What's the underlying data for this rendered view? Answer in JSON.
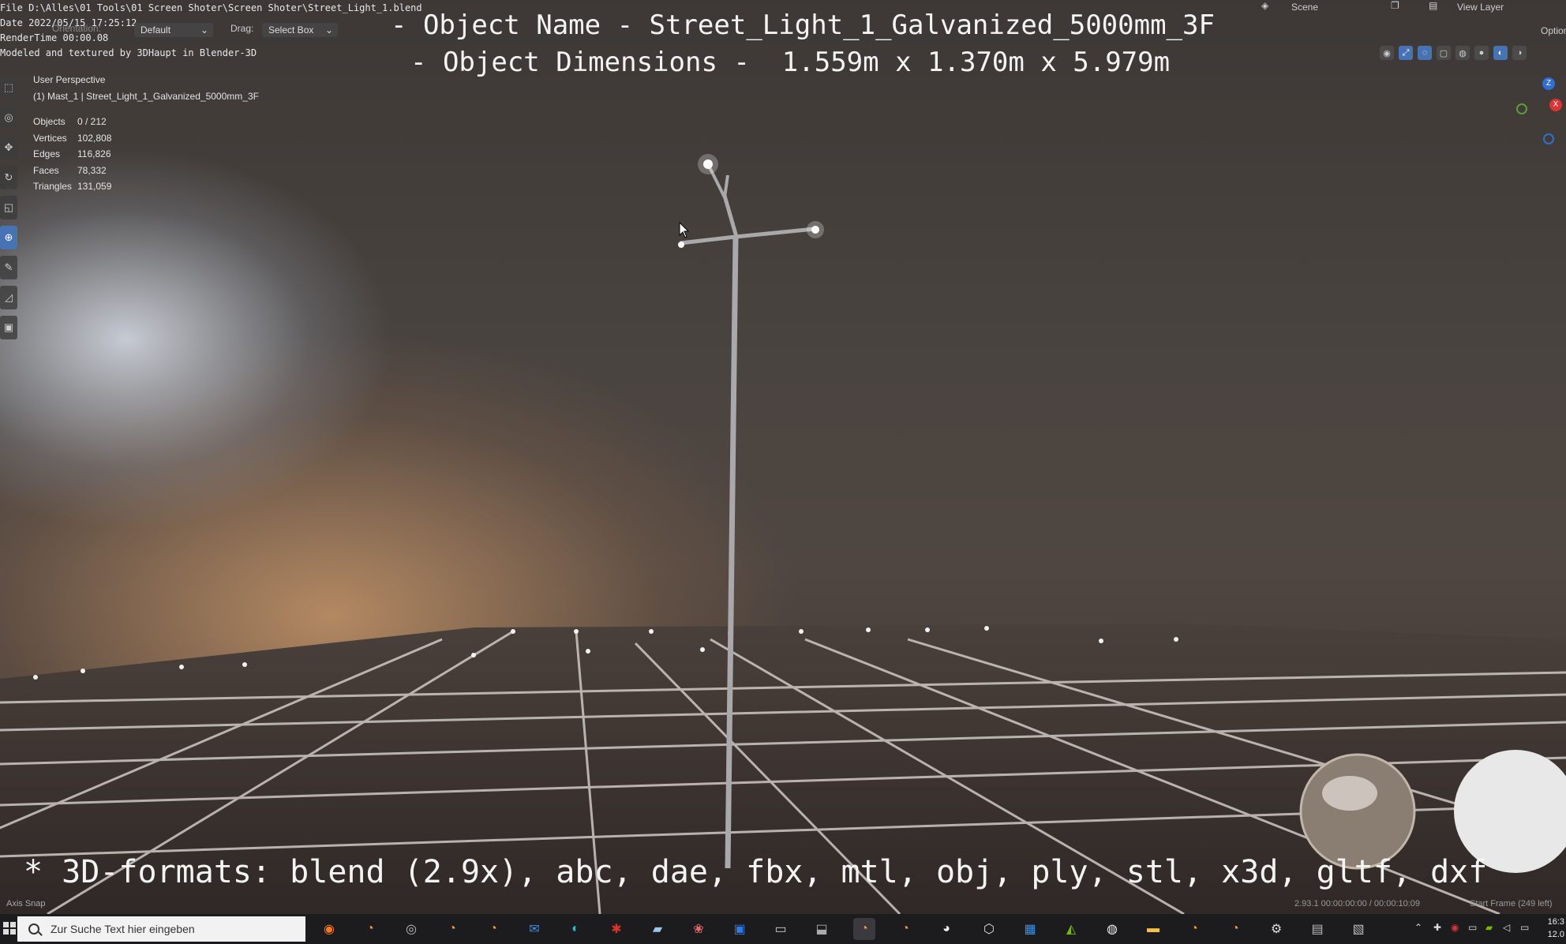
{
  "top_meta": {
    "file_line": "File D:\\Alles\\01 Tools\\01 Screen Shoter\\Screen Shoter\\Street_Light_1.blend",
    "date_line": "Date 2022/05/15 17:25:12",
    "rendertime_line": "RenderTime 00:00.08",
    "modeled_line": "Modeled and textured by 3DHaupt in Blender-3D"
  },
  "header": {
    "orientation_label": "Orientation:",
    "orientation_value": "Default",
    "drag_label": "Drag:",
    "drag_value": "Select Box",
    "scene_label": "Scene",
    "view_layer_label": "View Layer",
    "options_label": "Options"
  },
  "overlay": {
    "object_name_line": "- Object Name - Street_Light_1_Galvanized_5000mm_3F",
    "object_dimensions_line": "- Object Dimensions -  1.559m x 1.370m x 5.979m",
    "formats_line": "* 3D-formats: blend (2.9x), abc, dae, fbx, mtl, obj, ply, stl, x3d, gltf, dxf"
  },
  "viewport": {
    "perspective_label": "User Perspective",
    "active_object": "(1) Mast_1 | Street_Light_1_Galvanized_5000mm_3F",
    "stats": [
      {
        "key": "Objects",
        "value": "0 / 212"
      },
      {
        "key": "Vertices",
        "value": "102,808"
      },
      {
        "key": "Edges",
        "value": "116,826"
      },
      {
        "key": "Faces",
        "value": "78,332"
      },
      {
        "key": "Triangles",
        "value": "131,059"
      }
    ],
    "gizmo_labels": {
      "z": "Z",
      "x": "X"
    }
  },
  "status_bar": {
    "axis_snap": "Axis Snap",
    "version_time": "2.93.1  00:00:00:00 / 00:00:10:09",
    "start_frame": "Start Frame (249 left)"
  },
  "taskbar": {
    "search_placeholder": "Zur Suche Text hier eingeben",
    "clock_time": "16:3",
    "clock_date": "12.0"
  }
}
